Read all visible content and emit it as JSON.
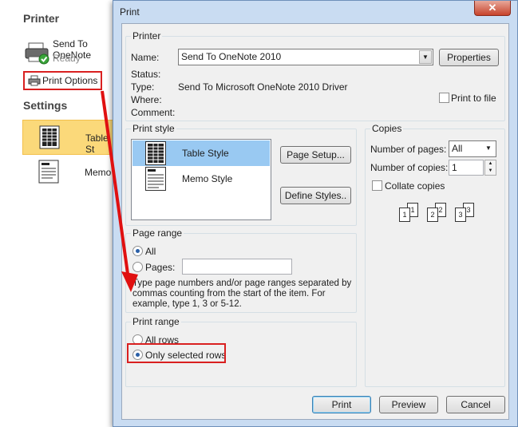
{
  "backstage": {
    "printer_heading": "Printer",
    "printer_name": "Send To OneNote",
    "printer_status": "Ready",
    "print_options_label": "Print Options",
    "settings_heading": "Settings",
    "settings_items": [
      {
        "label": "Table St"
      },
      {
        "label": "Memo"
      }
    ]
  },
  "dialog": {
    "title": "Print",
    "close_label": "✕",
    "printer": {
      "group_title": "Printer",
      "name_label": "Name:",
      "name_value": "Send To OneNote 2010",
      "properties_label": "Properties",
      "status_label": "Status:",
      "status_value": "",
      "type_label": "Type:",
      "type_value": "Send To Microsoft OneNote 2010 Driver",
      "where_label": "Where:",
      "where_value": "",
      "comment_label": "Comment:",
      "comment_value": "",
      "print_to_file_label": "Print to file",
      "print_to_file_checked": false
    },
    "print_style": {
      "group_title": "Print style",
      "items": [
        {
          "label": "Table Style",
          "selected": true
        },
        {
          "label": "Memo Style",
          "selected": false
        }
      ],
      "page_setup_label": "Page Setup...",
      "define_styles_label": "Define Styles.."
    },
    "copies": {
      "group_title": "Copies",
      "number_of_pages_label": "Number of pages:",
      "number_of_pages_value": "All",
      "number_of_copies_label": "Number of copies:",
      "number_of_copies_value": "1",
      "collate_label": "Collate copies",
      "collate_checked": false,
      "collate_pages": [
        "1",
        "1",
        "2",
        "2",
        "3",
        "3"
      ]
    },
    "page_range": {
      "group_title": "Page range",
      "all_label": "All",
      "pages_label": "Pages:",
      "pages_value": "",
      "selected": "all",
      "help_text_1": "Type page numbers and/or page ranges separated by",
      "help_text_2": "commas counting from the start of the item.  For",
      "help_text_3": "example, type 1, 3 or 5-12."
    },
    "print_range": {
      "group_title": "Print range",
      "all_rows_label": "All rows",
      "only_selected_label": "Only selected rows",
      "selected": "only_selected_rows"
    },
    "buttons": {
      "print_label": "Print",
      "preview_label": "Preview",
      "cancel_label": "Cancel"
    }
  },
  "colors": {
    "highlight_red": "#d92020",
    "selection_blue": "#99c9f2",
    "selected_setting_yellow": "#fbd97a"
  }
}
